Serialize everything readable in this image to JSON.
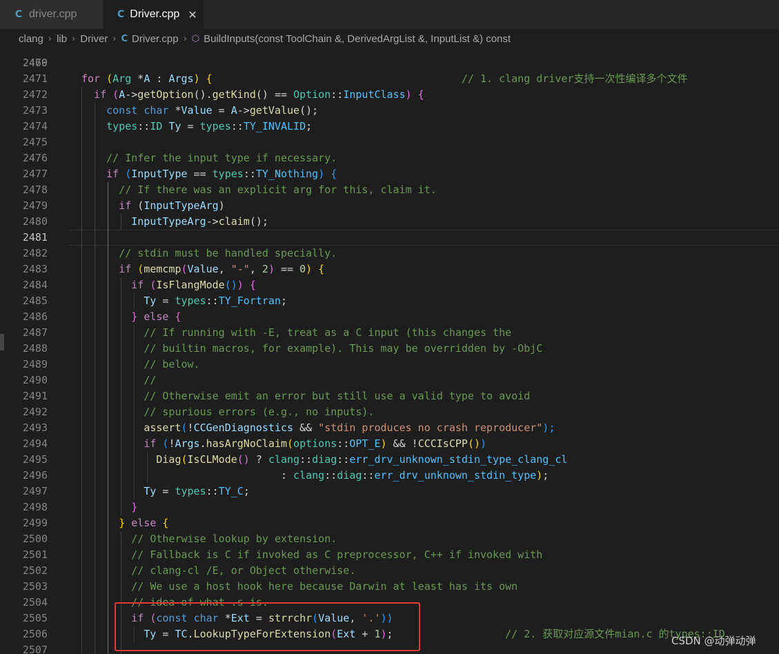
{
  "tabs": [
    {
      "label": "driver.cpp",
      "icon": "C++ file icon",
      "active": false
    },
    {
      "label": "Driver.cpp",
      "icon": "C++ file icon",
      "active": true,
      "close": "✕"
    }
  ],
  "icons": {
    "cpp": "C",
    "method": "⬡"
  },
  "breadcrumb": {
    "items": [
      "clang",
      "lib",
      "Driver",
      "Driver.cpp",
      "BuildInputs(const ToolChain &, DerivedArgList &, InputList &) const"
    ],
    "separator": "›"
  },
  "editor": {
    "first_line_partial": "2469",
    "current_line": "2481",
    "lines": [
      {
        "n": "2470",
        "t": []
      },
      {
        "n": "2471",
        "t": [
          [
            "for",
            "ctrl"
          ],
          [
            " (",
            "g1"
          ],
          [
            "Arg",
            "ty"
          ],
          [
            " *",
            ""
          ],
          [
            "A",
            "var"
          ],
          [
            " : ",
            ""
          ],
          [
            "Args",
            "var"
          ],
          [
            ") {",
            "g1"
          ],
          [
            "                                        ",
            ""
          ],
          [
            "// 1. clang driver支持一次性编译多个文件",
            "cm"
          ]
        ]
      },
      {
        "n": "2472",
        "t": [
          [
            "  ",
            ""
          ],
          [
            "if",
            "ctrl"
          ],
          [
            " (",
            "g2"
          ],
          [
            "A",
            "var"
          ],
          [
            "->",
            ""
          ],
          [
            "getOption",
            "fn"
          ],
          [
            "()",
            ""
          ],
          [
            ".",
            ""
          ],
          [
            "getKind",
            "fn"
          ],
          [
            "()",
            ""
          ],
          [
            " == ",
            ""
          ],
          [
            "Option",
            "ty"
          ],
          [
            "::",
            ""
          ],
          [
            "InputClass",
            "con"
          ],
          [
            ") {",
            "g2"
          ]
        ]
      },
      {
        "n": "2473",
        "t": [
          [
            "    ",
            ""
          ],
          [
            "const",
            "kw"
          ],
          [
            " ",
            ""
          ],
          [
            "char",
            "kw"
          ],
          [
            " *",
            ""
          ],
          [
            "Value",
            "var"
          ],
          [
            " = ",
            ""
          ],
          [
            "A",
            "var"
          ],
          [
            "->",
            ""
          ],
          [
            "getValue",
            "fn"
          ],
          [
            "();",
            ""
          ]
        ]
      },
      {
        "n": "2474",
        "t": [
          [
            "    ",
            ""
          ],
          [
            "types",
            "ty"
          ],
          [
            "::",
            ""
          ],
          [
            "ID",
            "ty"
          ],
          [
            " ",
            ""
          ],
          [
            "Ty",
            "var"
          ],
          [
            " = ",
            ""
          ],
          [
            "types",
            "ty"
          ],
          [
            "::",
            ""
          ],
          [
            "TY_INVALID",
            "con"
          ],
          [
            ";",
            ""
          ]
        ]
      },
      {
        "n": "2475",
        "t": []
      },
      {
        "n": "2476",
        "t": [
          [
            "    ",
            ""
          ],
          [
            "// Infer the input type if necessary.",
            "cm"
          ]
        ]
      },
      {
        "n": "2477",
        "t": [
          [
            "    ",
            ""
          ],
          [
            "if",
            "ctrl"
          ],
          [
            " (",
            "g3"
          ],
          [
            "InputType",
            "var"
          ],
          [
            " == ",
            ""
          ],
          [
            "types",
            "ty"
          ],
          [
            "::",
            ""
          ],
          [
            "TY_Nothing",
            "con"
          ],
          [
            ") {",
            "g3"
          ]
        ]
      },
      {
        "n": "2478",
        "t": [
          [
            "      ",
            ""
          ],
          [
            "// If there was an explicit arg for this, claim it.",
            "cm"
          ]
        ]
      },
      {
        "n": "2479",
        "t": [
          [
            "      ",
            ""
          ],
          [
            "if",
            "ctrl"
          ],
          [
            " (",
            ""
          ],
          [
            "InputTypeArg",
            "var"
          ],
          [
            ")",
            ""
          ]
        ]
      },
      {
        "n": "2480",
        "t": [
          [
            "        ",
            ""
          ],
          [
            "InputTypeArg",
            "var"
          ],
          [
            "->",
            ""
          ],
          [
            "claim",
            "fn"
          ],
          [
            "();",
            ""
          ]
        ]
      },
      {
        "n": "2481",
        "t": []
      },
      {
        "n": "2482",
        "t": [
          [
            "      ",
            ""
          ],
          [
            "// stdin must be handled specially.",
            "cm"
          ]
        ]
      },
      {
        "n": "2483",
        "t": [
          [
            "      ",
            ""
          ],
          [
            "if",
            "ctrl"
          ],
          [
            " (",
            "g1"
          ],
          [
            "memcmp",
            "fn"
          ],
          [
            "(",
            "g2"
          ],
          [
            "Value",
            "var"
          ],
          [
            ", ",
            ""
          ],
          [
            "\"-\"",
            "str"
          ],
          [
            ", ",
            ""
          ],
          [
            "2",
            "num"
          ],
          [
            ")",
            "g2"
          ],
          [
            " == ",
            ""
          ],
          [
            "0",
            "num"
          ],
          [
            ") {",
            "g1"
          ]
        ]
      },
      {
        "n": "2484",
        "t": [
          [
            "        ",
            ""
          ],
          [
            "if",
            "ctrl"
          ],
          [
            " (",
            "g2"
          ],
          [
            "IsFlangMode",
            "fn"
          ],
          [
            "()",
            "g3"
          ],
          [
            ") {",
            "g2"
          ]
        ]
      },
      {
        "n": "2485",
        "t": [
          [
            "          ",
            ""
          ],
          [
            "Ty",
            "var"
          ],
          [
            " = ",
            ""
          ],
          [
            "types",
            "ty"
          ],
          [
            "::",
            ""
          ],
          [
            "TY_Fortran",
            "con"
          ],
          [
            ";",
            ""
          ]
        ]
      },
      {
        "n": "2486",
        "t": [
          [
            "        ",
            ""
          ],
          [
            "}",
            "g2"
          ],
          [
            " ",
            ""
          ],
          [
            "else",
            "ctrl"
          ],
          [
            " {",
            "g2"
          ]
        ]
      },
      {
        "n": "2487",
        "t": [
          [
            "          ",
            ""
          ],
          [
            "// If running with -E, treat as a C input (this changes the",
            "cm"
          ]
        ]
      },
      {
        "n": "2488",
        "t": [
          [
            "          ",
            ""
          ],
          [
            "// builtin macros, for example). This may be overridden by -ObjC",
            "cm"
          ]
        ]
      },
      {
        "n": "2489",
        "t": [
          [
            "          ",
            ""
          ],
          [
            "// below.",
            "cm"
          ]
        ]
      },
      {
        "n": "2490",
        "t": [
          [
            "          ",
            ""
          ],
          [
            "//",
            "cm"
          ]
        ]
      },
      {
        "n": "2491",
        "t": [
          [
            "          ",
            ""
          ],
          [
            "// Otherwise emit an error but still use a valid type to avoid",
            "cm"
          ]
        ]
      },
      {
        "n": "2492",
        "t": [
          [
            "          ",
            ""
          ],
          [
            "// spurious errors (e.g., no inputs).",
            "cm"
          ]
        ]
      },
      {
        "n": "2493",
        "t": [
          [
            "          ",
            ""
          ],
          [
            "assert",
            "fn"
          ],
          [
            "(",
            "g3"
          ],
          [
            "!",
            ""
          ],
          [
            "CCGenDiagnostics",
            "var"
          ],
          [
            " && ",
            ""
          ],
          [
            "\"stdin produces no crash reproducer\"",
            "str"
          ],
          [
            ");",
            "g3"
          ]
        ]
      },
      {
        "n": "2494",
        "t": [
          [
            "          ",
            ""
          ],
          [
            "if",
            "ctrl"
          ],
          [
            " (",
            "g3"
          ],
          [
            "!",
            ""
          ],
          [
            "Args",
            "var"
          ],
          [
            ".",
            ""
          ],
          [
            "hasArgNoClaim",
            "fn"
          ],
          [
            "(",
            "g1"
          ],
          [
            "options",
            "ty"
          ],
          [
            "::",
            ""
          ],
          [
            "OPT_E",
            "con"
          ],
          [
            ")",
            "g1"
          ],
          [
            " && !",
            ""
          ],
          [
            "CCCIsCPP",
            "fn"
          ],
          [
            "()",
            "g1"
          ],
          [
            ")",
            "g3"
          ]
        ]
      },
      {
        "n": "2495",
        "t": [
          [
            "            ",
            ""
          ],
          [
            "Diag",
            "fn"
          ],
          [
            "(",
            "g1"
          ],
          [
            "IsCLMode",
            "fn"
          ],
          [
            "()",
            "g2"
          ],
          [
            " ? ",
            ""
          ],
          [
            "clang",
            "ty"
          ],
          [
            "::",
            ""
          ],
          [
            "diag",
            "ty"
          ],
          [
            "::",
            ""
          ],
          [
            "err_drv_unknown_stdin_type_clang_cl",
            "con"
          ]
        ]
      },
      {
        "n": "2496",
        "t": [
          [
            "                                ",
            ""
          ],
          [
            ": ",
            ""
          ],
          [
            "clang",
            "ty"
          ],
          [
            "::",
            ""
          ],
          [
            "diag",
            "ty"
          ],
          [
            "::",
            ""
          ],
          [
            "err_drv_unknown_stdin_type",
            "con"
          ],
          [
            ")",
            "g1"
          ],
          [
            ";",
            ""
          ]
        ]
      },
      {
        "n": "2497",
        "t": [
          [
            "          ",
            ""
          ],
          [
            "Ty",
            "var"
          ],
          [
            " = ",
            ""
          ],
          [
            "types",
            "ty"
          ],
          [
            "::",
            ""
          ],
          [
            "TY_C",
            "con"
          ],
          [
            ";",
            ""
          ]
        ]
      },
      {
        "n": "2498",
        "t": [
          [
            "        ",
            ""
          ],
          [
            "}",
            "g2"
          ]
        ]
      },
      {
        "n": "2499",
        "t": [
          [
            "      ",
            ""
          ],
          [
            "}",
            "g1"
          ],
          [
            " ",
            ""
          ],
          [
            "else",
            "ctrl"
          ],
          [
            " {",
            "g1"
          ]
        ]
      },
      {
        "n": "2500",
        "t": [
          [
            "        ",
            ""
          ],
          [
            "// Otherwise lookup by extension.",
            "cm"
          ]
        ]
      },
      {
        "n": "2501",
        "t": [
          [
            "        ",
            ""
          ],
          [
            "// Fallback is C if invoked as C preprocessor, C++ if invoked with",
            "cm"
          ]
        ]
      },
      {
        "n": "2502",
        "t": [
          [
            "        ",
            ""
          ],
          [
            "// clang-cl /E, or Object otherwise.",
            "cm"
          ]
        ]
      },
      {
        "n": "2503",
        "t": [
          [
            "        ",
            ""
          ],
          [
            "// We use a host hook here because Darwin at least has its own",
            "cm"
          ]
        ]
      },
      {
        "n": "2504",
        "t": [
          [
            "        ",
            ""
          ],
          [
            "// idea of what .s is.",
            "cm"
          ]
        ]
      },
      {
        "n": "2505",
        "t": [
          [
            "        ",
            ""
          ],
          [
            "if",
            "ctrl"
          ],
          [
            " (",
            "g2"
          ],
          [
            "const",
            "kw"
          ],
          [
            " ",
            ""
          ],
          [
            "char",
            "kw"
          ],
          [
            " *",
            ""
          ],
          [
            "Ext",
            "var"
          ],
          [
            " = ",
            ""
          ],
          [
            "strrchr",
            "fn"
          ],
          [
            "(",
            "g3"
          ],
          [
            "Value",
            "var"
          ],
          [
            ", ",
            ""
          ],
          [
            "'.'",
            "str"
          ],
          [
            "))",
            "g3"
          ]
        ]
      },
      {
        "n": "2506",
        "t": [
          [
            "          ",
            ""
          ],
          [
            "Ty",
            "var"
          ],
          [
            " = ",
            ""
          ],
          [
            "TC",
            "var"
          ],
          [
            ".",
            ""
          ],
          [
            "LookupTypeForExtension",
            "fn"
          ],
          [
            "(",
            "g2"
          ],
          [
            "Ext",
            "var"
          ],
          [
            " + ",
            ""
          ],
          [
            "1",
            "num"
          ],
          [
            ")",
            "g2"
          ],
          [
            ";",
            ""
          ],
          [
            "                  ",
            ""
          ],
          [
            "// 2. 获取对应源文件mian.c 的types::ID",
            "cm"
          ]
        ]
      },
      {
        "n": "2507",
        "t": []
      }
    ]
  },
  "watermark": "CSDN @动弹动弹"
}
